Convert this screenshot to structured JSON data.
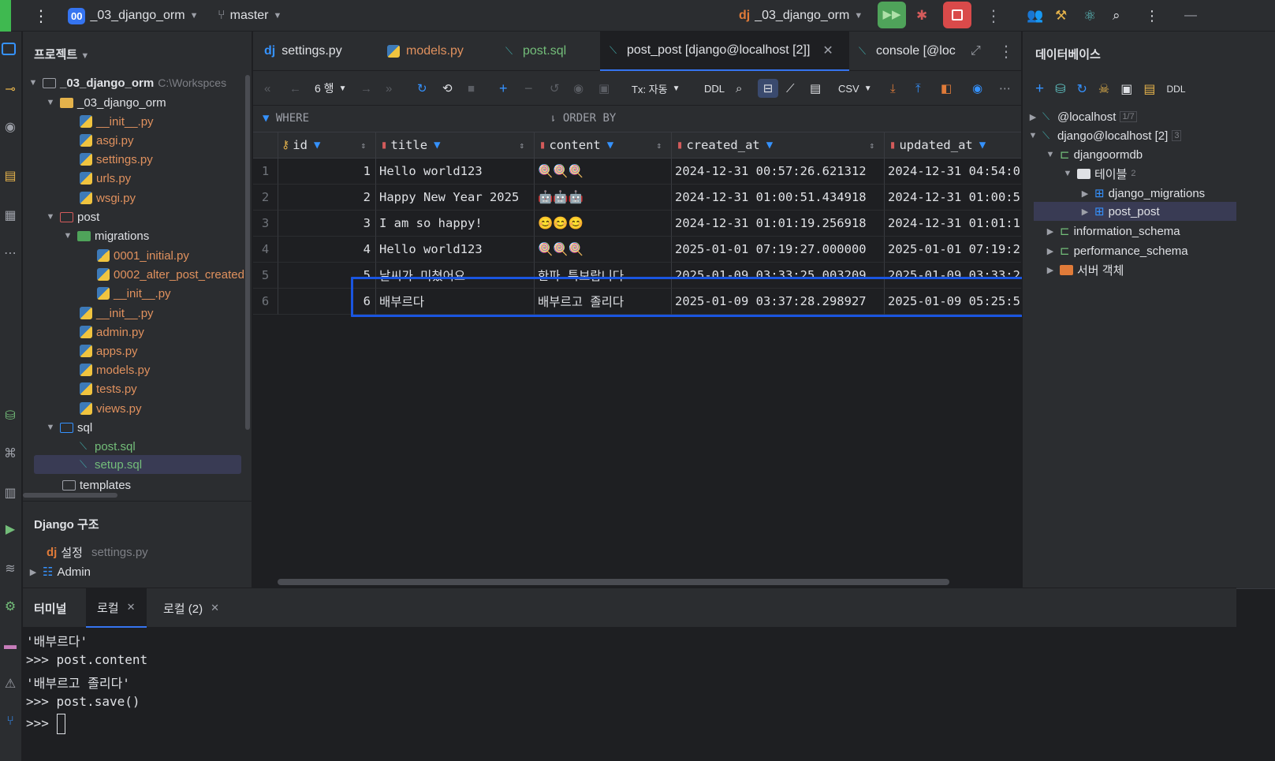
{
  "titlebar": {
    "project_badge": "00",
    "project_name": "_03_django_orm",
    "branch": "master",
    "run_config": "_03_django_orm"
  },
  "project_panel": {
    "title": "프로젝트",
    "tree": [
      {
        "label": "_03_django_orm",
        "path": "C:\\Workspces",
        "kind": "root"
      },
      {
        "label": "_03_django_orm",
        "kind": "folder"
      },
      {
        "label": "__init__.py",
        "kind": "py"
      },
      {
        "label": "asgi.py",
        "kind": "py"
      },
      {
        "label": "settings.py",
        "kind": "py"
      },
      {
        "label": "urls.py",
        "kind": "py"
      },
      {
        "label": "wsgi.py",
        "kind": "py"
      },
      {
        "label": "post",
        "kind": "folder"
      },
      {
        "label": "migrations",
        "kind": "folder"
      },
      {
        "label": "0001_initial.py",
        "kind": "py"
      },
      {
        "label": "0002_alter_post_created",
        "kind": "py"
      },
      {
        "label": "__init__.py",
        "kind": "py"
      },
      {
        "label": "__init__.py",
        "kind": "py"
      },
      {
        "label": "admin.py",
        "kind": "py"
      },
      {
        "label": "apps.py",
        "kind": "py"
      },
      {
        "label": "models.py",
        "kind": "py"
      },
      {
        "label": "tests.py",
        "kind": "py"
      },
      {
        "label": "views.py",
        "kind": "py"
      },
      {
        "label": "sql",
        "kind": "folder"
      },
      {
        "label": "post.sql",
        "kind": "sql"
      },
      {
        "label": "setup.sql",
        "kind": "sql"
      },
      {
        "label": "templates",
        "kind": "folder"
      }
    ],
    "django_structure": {
      "title": "Django 구조",
      "settings_label": "설정",
      "settings_file": "settings.py",
      "admin_label": "Admin"
    }
  },
  "editor_tabs": [
    {
      "label": "settings.py"
    },
    {
      "label": "models.py"
    },
    {
      "label": "post.sql"
    },
    {
      "label": "post_post [django@localhost [2]]"
    },
    {
      "label": "console [@loc"
    }
  ],
  "toolbar": {
    "rows_label": "6 행",
    "tx_label": "Tx: 자동",
    "ddl_label": "DDL",
    "csv_label": "CSV"
  },
  "filters": {
    "where": "WHERE",
    "order_by": "ORDER BY"
  },
  "grid": {
    "columns": [
      "id",
      "title",
      "content",
      "created_at",
      "updated_at"
    ],
    "rows": [
      {
        "n": "1",
        "id": "1",
        "title": "Hello world123",
        "content": "🍭🍭🍭",
        "created_at": "2024-12-31 00:57:26.621312",
        "updated_at": "2024-12-31 04:54:0"
      },
      {
        "n": "2",
        "id": "2",
        "title": "Happy New Year 2025",
        "content": "🤖🤖🤖",
        "created_at": "2024-12-31 01:00:51.434918",
        "updated_at": "2024-12-31 01:00:5"
      },
      {
        "n": "3",
        "id": "3",
        "title": "I am so happy!",
        "content": "😊😊😊",
        "created_at": "2024-12-31 01:01:19.256918",
        "updated_at": "2024-12-31 01:01:1"
      },
      {
        "n": "4",
        "id": "4",
        "title": "Hello world123",
        "content": "🍭🍭🍭",
        "created_at": "2025-01-01 07:19:27.000000",
        "updated_at": "2025-01-01 07:19:2"
      },
      {
        "n": "5",
        "id": "5",
        "title": "날씨가 미쳤어요",
        "content": "한파 특보랍니다",
        "created_at": "2025-01-09 03:33:25.003209",
        "updated_at": "2025-01-09 03:33:2"
      },
      {
        "n": "6",
        "id": "6",
        "title": "배부르다",
        "content": "배부르고 졸리다",
        "created_at": "2025-01-09 03:37:28.298927",
        "updated_at": "2025-01-09 05:25:5"
      }
    ]
  },
  "database_panel": {
    "title": "데이터베이스",
    "ddl_label": "DDL",
    "tree": [
      {
        "label": "@localhost",
        "badge": "1/7"
      },
      {
        "label": "django@localhost [2]",
        "badge": "3"
      },
      {
        "label": "djangoormdb",
        "badge": ""
      },
      {
        "label": "테이블",
        "badge": "2"
      },
      {
        "label": "django_migrations",
        "badge": ""
      },
      {
        "label": "post_post",
        "badge": ""
      },
      {
        "label": "information_schema",
        "badge": ""
      },
      {
        "label": "performance_schema",
        "badge": ""
      },
      {
        "label": "서버 객체",
        "badge": ""
      }
    ]
  },
  "terminal": {
    "tabs": [
      "터미널",
      "로컬",
      "로컬 (2)"
    ],
    "lines": [
      "'배부르다'",
      ">>> post.content",
      "'배부르고 졸리다'",
      ">>> post.save()",
      ">>> "
    ]
  },
  "colors": {
    "accent": "#3574f0",
    "highlight_box": "#1a55e0",
    "run_green": "#4fa35a",
    "stop_red": "#d94a4a"
  }
}
